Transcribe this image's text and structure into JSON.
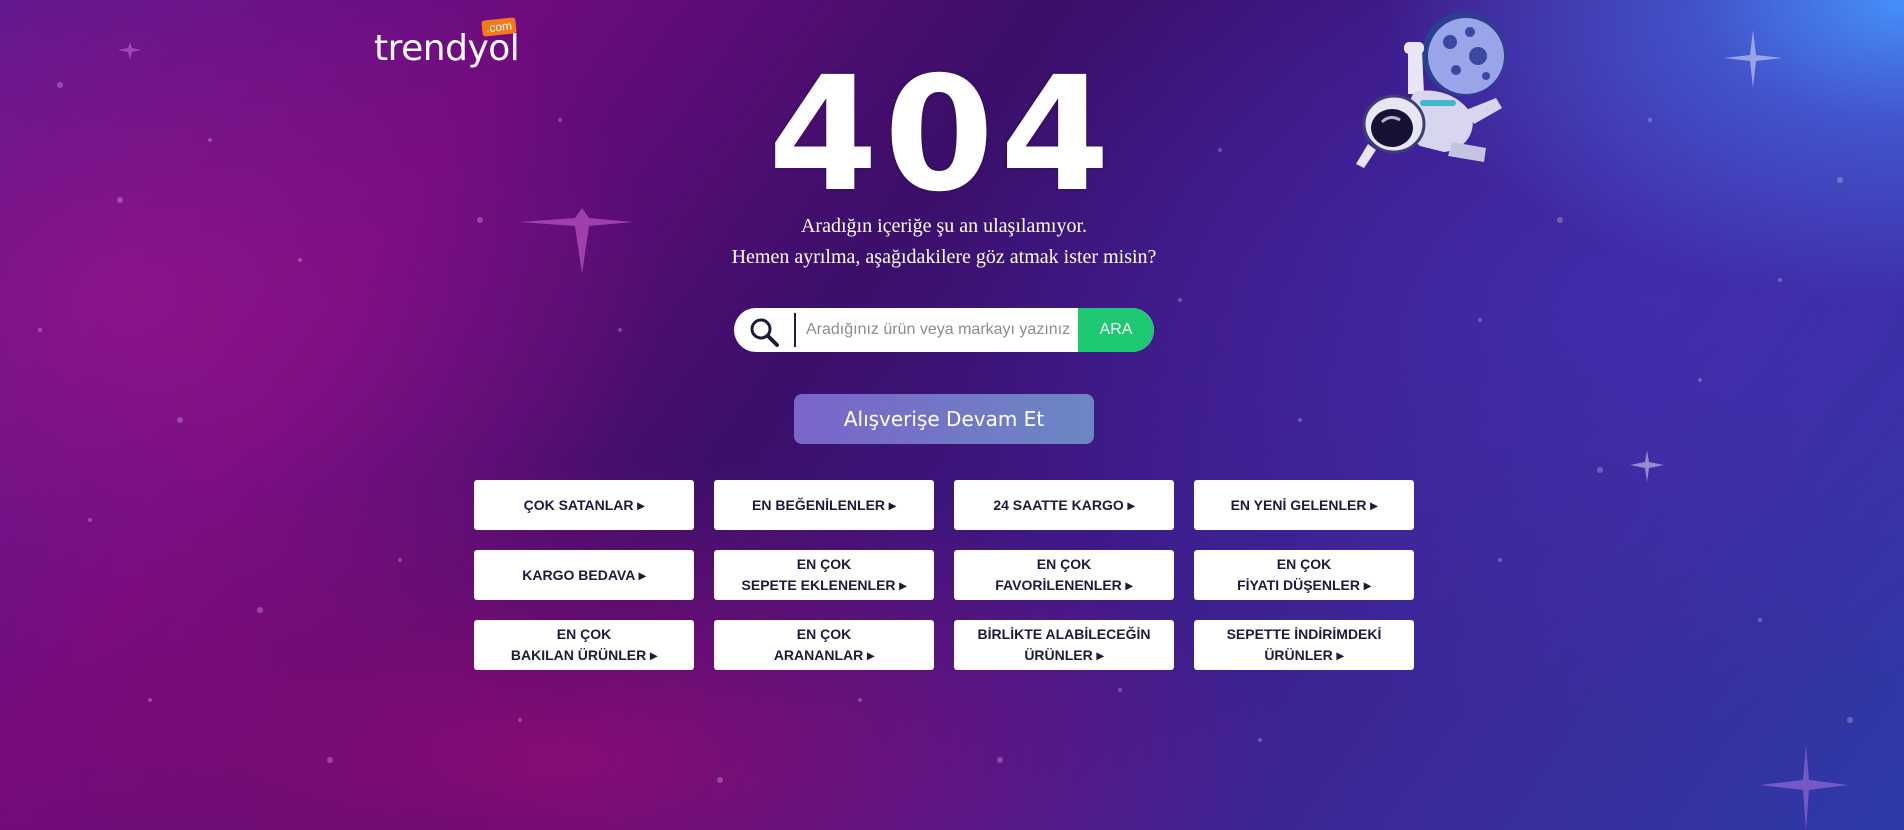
{
  "brand": {
    "logo_text": "trendyol",
    "logo_suffix": ".com",
    "accent_color": "#f27a1a"
  },
  "error": {
    "code": "404",
    "line1": "Aradığın içeriğe şu an ulaşılamıyor.",
    "line2": "Hemen ayrılma, aşağıdakilere göz atmak ister misin?"
  },
  "search": {
    "icon": "search-icon",
    "placeholder": "Aradığınız ürün veya markayı yazınız",
    "button_label": "ARA",
    "button_color": "#1ec873"
  },
  "continue_button": {
    "label": "Alışverişe Devam Et"
  },
  "links": [
    {
      "label": "ÇOK SATANLAR ▸"
    },
    {
      "label": "EN BEĞENİLENLER ▸"
    },
    {
      "label": "24 SAATTE KARGO ▸"
    },
    {
      "label": "EN YENİ GELENLER ▸"
    },
    {
      "label": "KARGO BEDAVA ▸"
    },
    {
      "label": "EN ÇOK\nSEPETE EKLENENLER ▸"
    },
    {
      "label": "EN ÇOK\nFAVORİLENENLER ▸"
    },
    {
      "label": "EN ÇOK\nFİYATI DÜŞENLER ▸"
    },
    {
      "label": "EN ÇOK\nBAKILAN ÜRÜNLER ▸"
    },
    {
      "label": "EN ÇOK\nARANANLAR ▸"
    },
    {
      "label": "BİRLİKTE ALABİLECEĞİN\nÜRÜNLER ▸"
    },
    {
      "label": "SEPETTE İNDİRİMDEKİ\nÜRÜNLER ▸"
    }
  ],
  "illustration": {
    "icon": "astronaut-icon"
  }
}
